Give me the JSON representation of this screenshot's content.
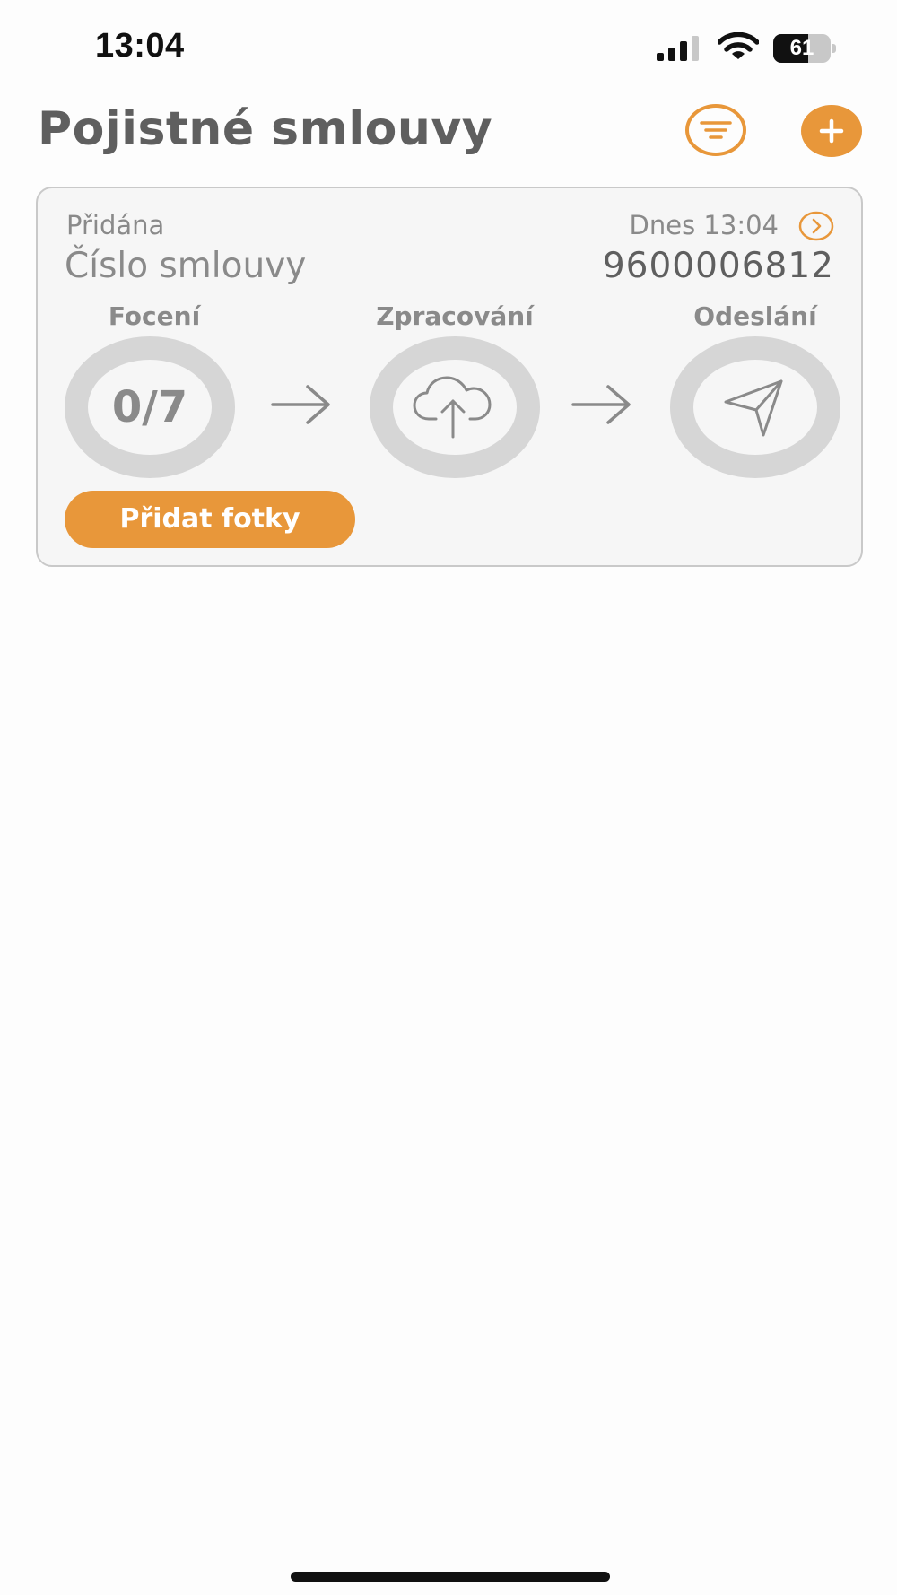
{
  "status_bar": {
    "time": "13:04",
    "battery_level": "61",
    "battery_fraction": 0.61,
    "signal_icon": "cellular-signal-icon",
    "wifi_icon": "wifi-icon",
    "battery_icon": "battery-icon"
  },
  "header": {
    "title": "Pojistné smlouvy",
    "filter_icon": "filter-icon",
    "add_icon": "plus-icon"
  },
  "card": {
    "added_label": "Přidána",
    "date": "Dnes 13:04",
    "number_label": "Číslo smlouvy",
    "number_value": "9600006812",
    "steps": [
      {
        "label": "Focení",
        "value": "0/7"
      },
      {
        "label": "Zpracování",
        "icon": "cloud-upload-icon"
      },
      {
        "label": "Odeslání",
        "icon": "send-icon"
      }
    ],
    "add_photos_label": "Přidat fotky"
  },
  "colors": {
    "accent": "#e8973a",
    "ring": "#d6d6d6",
    "text_muted": "#8a8a8a",
    "text_dark": "#5f5f5f"
  }
}
